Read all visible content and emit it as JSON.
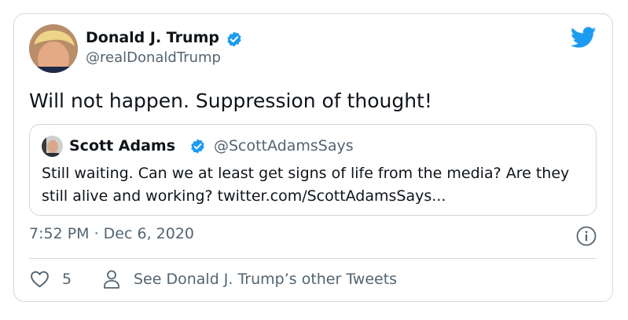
{
  "tweet": {
    "author_name": "Donald J. Trump",
    "author_handle": "@realDonaldTrump",
    "text": "Will not happen. Suppression of thought!",
    "timestamp": "7:52 PM · Dec 6, 2020",
    "likes": "5",
    "other_tweets_label": "See Donald J. Trump’s other Tweets"
  },
  "quoted": {
    "author_name": "Scott Adams",
    "author_handle": "@ScottAdamsSays",
    "text": "Still waiting. Can we at least get signs of life from the media? Are they still alive and working? twitter.com/ScottAdamsSays..."
  },
  "colors": {
    "brand_blue": "#1d9bf0",
    "secondary_text": "#536471",
    "border": "#cfd9de"
  },
  "icons": [
    "verified-badge-icon",
    "twitter-bird-icon",
    "info-icon",
    "heart-icon",
    "person-icon"
  ]
}
